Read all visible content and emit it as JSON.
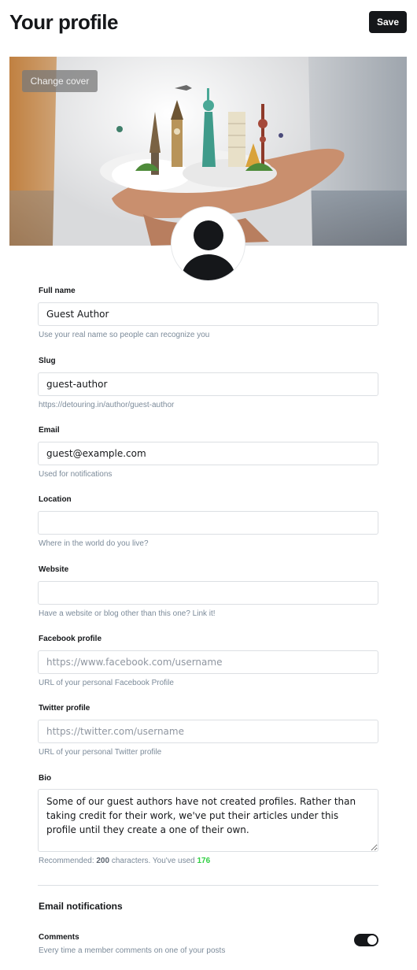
{
  "header": {
    "title": "Your profile",
    "save_label": "Save"
  },
  "cover": {
    "change_cover_label": "Change cover"
  },
  "fields": {
    "full_name": {
      "label": "Full name",
      "value": "Guest Author",
      "hint": "Use your real name so people can recognize you"
    },
    "slug": {
      "label": "Slug",
      "value": "guest-author",
      "hint": "https://detouring.in/author/guest-author"
    },
    "email": {
      "label": "Email",
      "value": "guest@example.com",
      "hint": "Used for notifications"
    },
    "location": {
      "label": "Location",
      "value": "",
      "hint": "Where in the world do you live?"
    },
    "website": {
      "label": "Website",
      "value": "",
      "hint": "Have a website or blog other than this one? Link it!"
    },
    "facebook": {
      "label": "Facebook profile",
      "value": "",
      "placeholder": "https://www.facebook.com/username",
      "hint": "URL of your personal Facebook Profile"
    },
    "twitter": {
      "label": "Twitter profile",
      "value": "",
      "placeholder": "https://twitter.com/username",
      "hint": "URL of your personal Twitter profile"
    },
    "bio": {
      "label": "Bio",
      "value": "Some of our guest authors have not created profiles. Rather than taking credit for their work, we've put their articles under this profile until they create a one of their own.",
      "hint_prefix": "Recommended:",
      "recommended_count": "200",
      "hint_middle": "characters. You've used",
      "used_count": "176"
    }
  },
  "notifications": {
    "section_title": "Email notifications",
    "comments": {
      "label": "Comments",
      "description": "Every time a member comments on one of your posts",
      "enabled": true
    }
  },
  "colors": {
    "primary": "#15171a",
    "hint": "#7c8b9a",
    "success": "#30cf43",
    "border": "#dcdfe3"
  }
}
